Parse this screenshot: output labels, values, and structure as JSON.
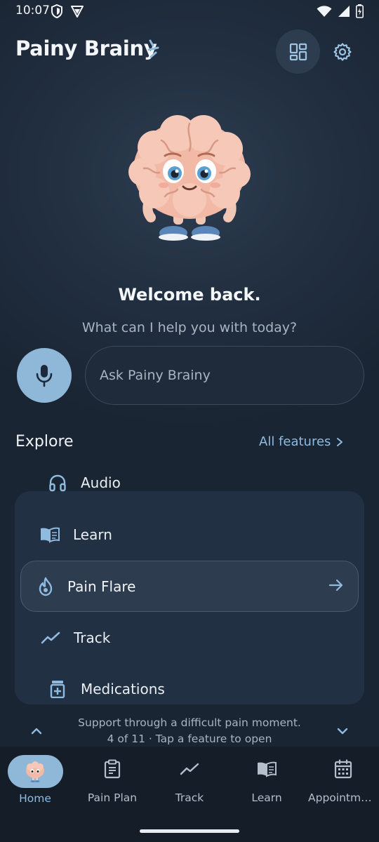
{
  "status_bar": {
    "time": "10:07",
    "icons": [
      "shield-icon",
      "vpn-icon",
      "wifi-icon",
      "signal-icon",
      "battery-icon"
    ]
  },
  "header": {
    "title": "Painy Brainy",
    "actions": [
      "dashboard-grid-icon",
      "settings-gear-icon"
    ]
  },
  "mascot": "brain-mascot",
  "welcome": {
    "title": "Welcome back.",
    "subtitle": "What can I help you with today?"
  },
  "ask": {
    "placeholder": "Ask Painy Brainy",
    "mic_icon": "microphone-icon"
  },
  "explore": {
    "title": "Explore",
    "all_features": "All features",
    "items": [
      {
        "label": "Audio",
        "icon": "headphones-icon"
      },
      {
        "label": "Learn",
        "icon": "open-book-icon"
      },
      {
        "label": "Pain Flare",
        "icon": "flame-icon",
        "selected": true
      },
      {
        "label": "Track",
        "icon": "trend-line-icon"
      },
      {
        "label": "Medications",
        "icon": "medication-icon"
      }
    ],
    "description": "Support through a difficult pain moment.",
    "position": "4 of 11 · Tap a feature to open"
  },
  "bottom_nav": {
    "items": [
      {
        "label": "Home",
        "icon": "brain-mascot-icon",
        "active": true
      },
      {
        "label": "Pain Plan",
        "icon": "clipboard-icon"
      },
      {
        "label": "Track",
        "icon": "trend-line-icon"
      },
      {
        "label": "Learn",
        "icon": "open-book-icon"
      },
      {
        "label": "Appointme…",
        "icon": "calendar-icon"
      }
    ]
  },
  "colors": {
    "background": "#1b2736",
    "accent": "#8fb8d8",
    "link": "#8fbbe0",
    "text_muted": "#a9b4c1"
  }
}
